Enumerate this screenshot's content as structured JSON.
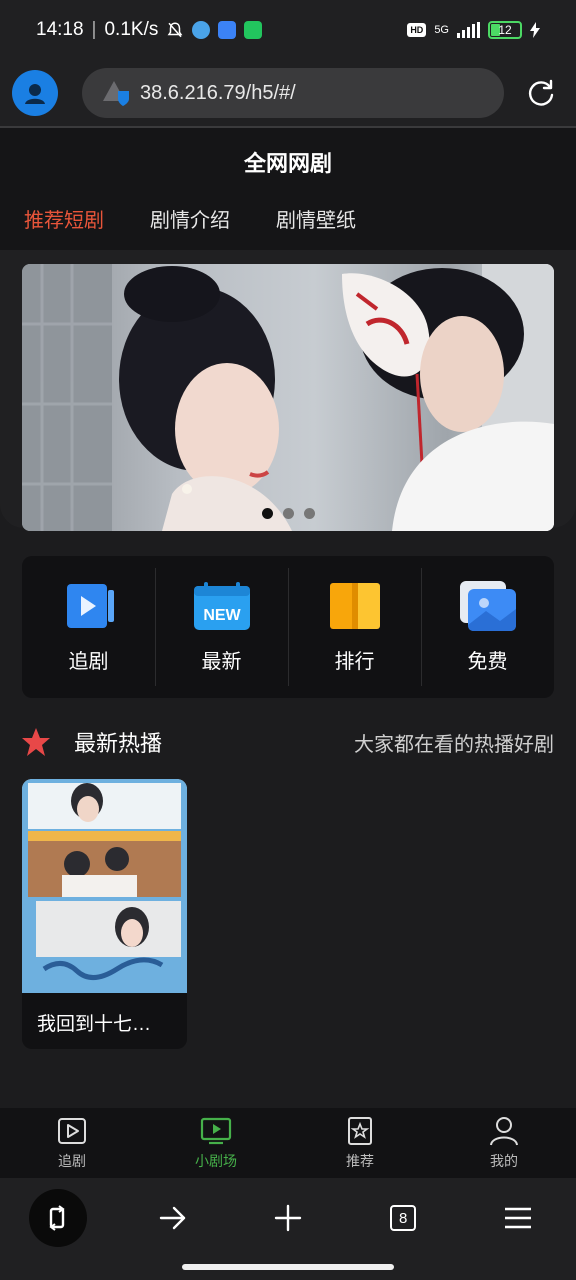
{
  "status_bar": {
    "time": "14:18",
    "speed": "0.1K/s",
    "network": "5G",
    "hd": "HD",
    "battery": "12"
  },
  "browser": {
    "url": "38.6.216.79/h5/#/",
    "tab_count": "8"
  },
  "header": {
    "title": "全网网剧",
    "tabs": [
      {
        "label": "推荐短剧",
        "active": true
      },
      {
        "label": "剧情介绍",
        "active": false
      },
      {
        "label": "剧情壁纸",
        "active": false
      }
    ]
  },
  "banner": {
    "slides": 3,
    "active_slide": 1
  },
  "quick_nav": [
    {
      "label": "追剧",
      "icon": "play-card-icon"
    },
    {
      "label": "最新",
      "icon": "new-badge-icon"
    },
    {
      "label": "排行",
      "icon": "book-icon"
    },
    {
      "label": "免费",
      "icon": "image-icon"
    }
  ],
  "section": {
    "title": "最新热播",
    "subtitle": "大家都在看的热播好剧"
  },
  "cards": [
    {
      "title": "我回到十七…"
    }
  ],
  "app_nav": [
    {
      "label": "追剧",
      "icon": "play-square-icon",
      "active": false
    },
    {
      "label": "小剧场",
      "icon": "tv-icon",
      "active": true
    },
    {
      "label": "推荐",
      "icon": "star-bookmark-icon",
      "active": false
    },
    {
      "label": "我的",
      "icon": "user-icon",
      "active": false
    }
  ],
  "colors": {
    "accent": "#e8553a",
    "active_nav": "#46b04a",
    "background": "#1c1c1e"
  }
}
